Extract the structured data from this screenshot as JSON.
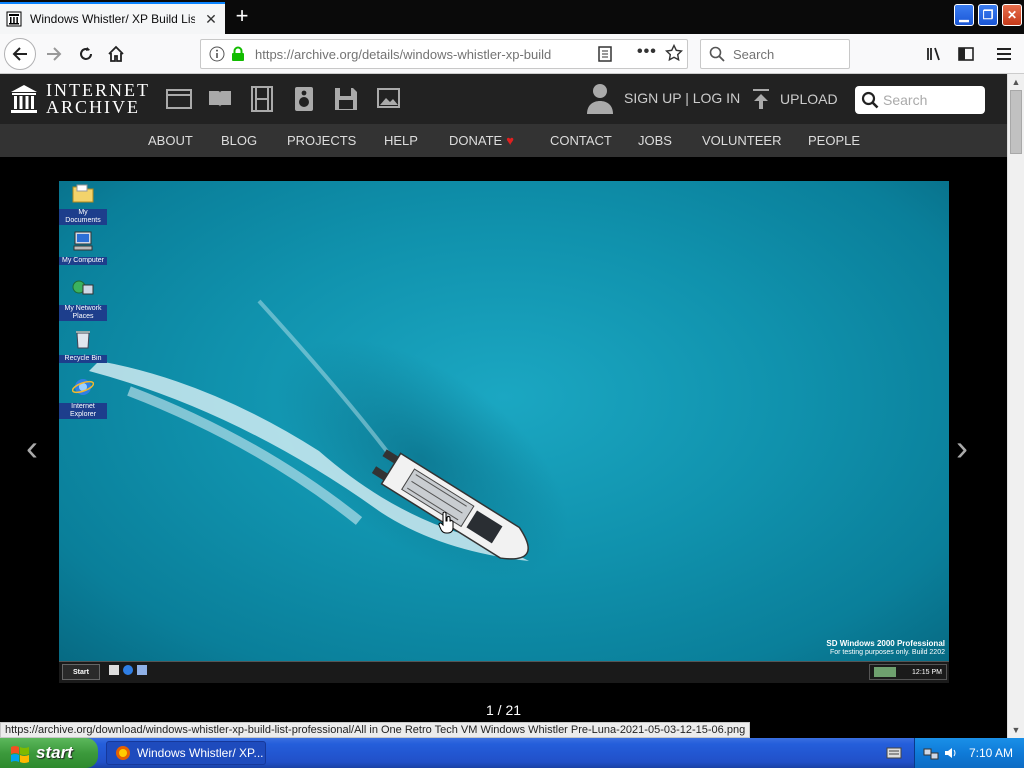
{
  "browser": {
    "tab_title": "Windows Whistler/ XP Build List Pr",
    "url_prefix": "https://archive.org",
    "url_path": "/details/windows-whistler-xp-build",
    "search_placeholder": "Search"
  },
  "ia": {
    "logo_line1": "INTERNET",
    "logo_line2": "ARCHIVE",
    "signup_label": "SIGN UP | LOG IN",
    "upload_label": "UPLOAD",
    "search_placeholder": "Search",
    "nav": [
      "ABOUT",
      "BLOG",
      "PROJECTS",
      "HELP",
      "DONATE",
      "CONTACT",
      "JOBS",
      "VOLUNTEER",
      "PEOPLE"
    ],
    "donate_heart": "♥"
  },
  "viewer": {
    "page_counter": "1 / 21",
    "prev_arrow": "‹",
    "next_arrow": "›"
  },
  "screenshot_desktop": {
    "icons": [
      "My Documents",
      "My Computer",
      "My Network Places",
      "Recycle Bin",
      "Internet Explorer"
    ],
    "caption_line1": "SD Windows 2000 Professional",
    "caption_line2": "For testing purposes only. Build 2202",
    "start_label": "Start",
    "clock": "12:15 PM"
  },
  "status_url": "https://archive.org/download/windows-whistler-xp-build-list-professional/All in One Retro Tech VM Windows Whistler Pre-Luna-2021-05-03-12-15-06.png",
  "taskbar": {
    "start_label": "start",
    "task_title": "Windows Whistler/ XP...",
    "clock": "7:10 AM"
  }
}
